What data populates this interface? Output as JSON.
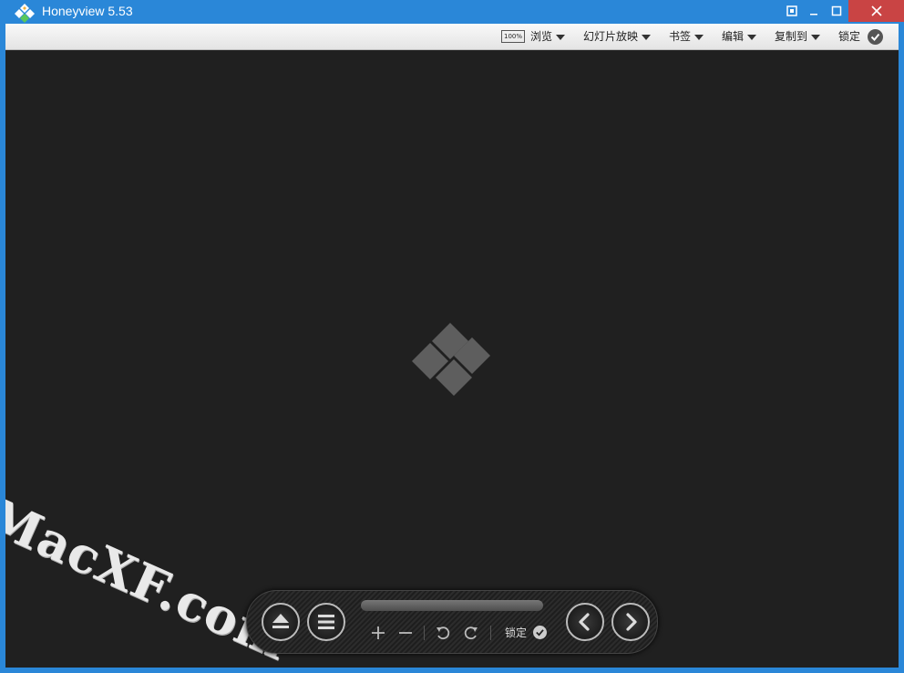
{
  "window": {
    "title": "Honeyview 5.53"
  },
  "menubar": {
    "zoom_badge": "100%",
    "items": [
      {
        "label": "浏览"
      },
      {
        "label": "幻灯片放映"
      },
      {
        "label": "书签"
      },
      {
        "label": "编辑"
      },
      {
        "label": "复制到"
      }
    ],
    "lock_label": "锁定"
  },
  "watermark": "MacXF.com",
  "toolbar": {
    "lock_label": "锁定",
    "progress": 0
  },
  "colors": {
    "titlebar": "#2a87d8",
    "close": "#c94444",
    "viewer_bg": "#202020"
  }
}
